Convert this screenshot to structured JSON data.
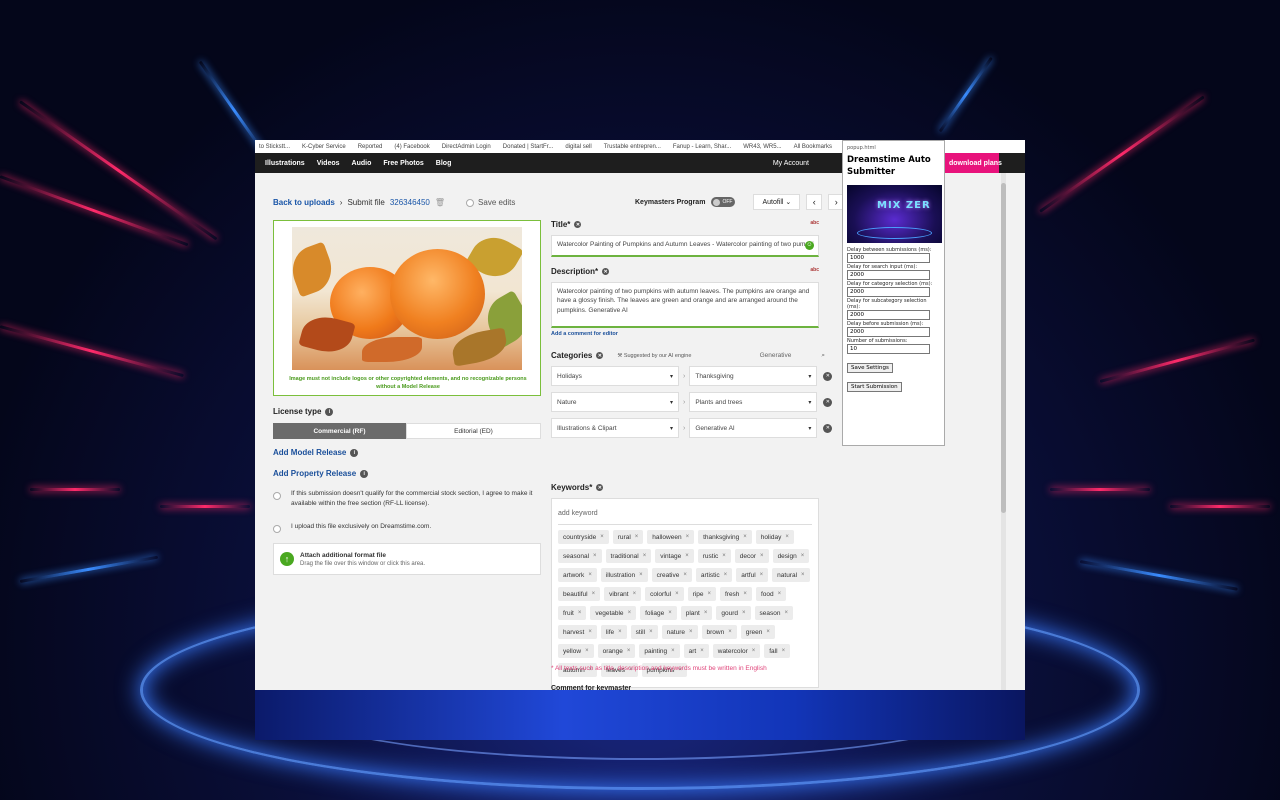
{
  "bookmarks": [
    "to Stickstt...",
    "K-Cyber Service",
    "Reported",
    "(4) Facebook",
    "DirectAdmin Login",
    "Donated | StartFr...",
    "digital sell",
    "Trustable entrepren...",
    "Fanup - Learn, Shar...",
    "WR43, WR5...",
    "All Bookmarks"
  ],
  "nav": {
    "items": [
      "Illustrations",
      "Videos",
      "Audio",
      "Free Photos",
      "Blog"
    ],
    "account": "My Account",
    "download_plans": "download plans"
  },
  "breadcrumb": {
    "back": "Back to uploads",
    "sep": "›",
    "submit": "Submit file",
    "file_number": "326346450",
    "save_edits": "Save edits"
  },
  "toolbar": {
    "keymasters": "Keymasters Program",
    "toggle": "OFF",
    "autofill": "Autofill",
    "prev": "‹",
    "next": "›"
  },
  "image_note": "Image must not include logos or other copyrighted elements, and no recognizable persons without a Model Release",
  "license": {
    "label": "License type",
    "commercial": "Commercial (RF)",
    "editorial": "Editorial (ED)"
  },
  "links": {
    "model_release": "Add Model Release",
    "property_release": "Add Property Release"
  },
  "options": {
    "free_section": "If this submission doesn't qualify for the commercial stock section, I agree to make it available within the free section (RF-LL license).",
    "exclusive": "I upload this file exclusively on Dreamstime.com."
  },
  "attach": {
    "title": "Attach additional format file",
    "subtitle": "Drag the file over this window or click this area."
  },
  "title_field": {
    "label": "Title*",
    "value": "Watercolor Painting of Pumpkins and Autumn Leaves - Watercolor painting of two pumpki",
    "badge": "abc"
  },
  "description_field": {
    "label": "Description*",
    "value": "Watercolor painting of two pumpkins with autumn leaves. The pumpkins are orange and have a glossy finish. The leaves are green and orange and are arranged around the pumpkins. Generative AI",
    "comment_link": "Add a comment for editor",
    "badge": "abc"
  },
  "categories": {
    "label": "Categories",
    "ai_hint": "Suggested by our AI engine",
    "search_value": "Generative",
    "rows": [
      {
        "main": "Holidays",
        "sub": "Thanksgiving"
      },
      {
        "main": "Nature",
        "sub": "Plants and trees"
      },
      {
        "main": "Illustrations & Clipart",
        "sub": "Generative AI"
      }
    ]
  },
  "keywords": {
    "label": "Keywords*",
    "placeholder": "add keyword",
    "tags": [
      "countryside",
      "rural",
      "halloween",
      "thanksgiving",
      "holiday",
      "seasonal",
      "traditional",
      "vintage",
      "rustic",
      "decor",
      "design",
      "artwork",
      "illustration",
      "creative",
      "artistic",
      "artful",
      "natural",
      "beautiful",
      "vibrant",
      "colorful",
      "ripe",
      "fresh",
      "food",
      "fruit",
      "vegetable",
      "foliage",
      "plant",
      "gourd",
      "season",
      "harvest",
      "life",
      "still",
      "nature",
      "brown",
      "green",
      "yellow",
      "orange",
      "painting",
      "art",
      "watercolor",
      "fall",
      "autumn",
      "leaves",
      "pumpkins"
    ]
  },
  "english_note": "* All texts such as title, description and keywords must be written in English",
  "comment_label": "Comment for keymaster",
  "popup": {
    "header": "popup.html",
    "title": "Dreamstime Auto Submitter",
    "logo_text": "MIX ZER",
    "fields": [
      {
        "label": "Delay between submissions (ms):",
        "value": "1000"
      },
      {
        "label": "Delay for search input (ms):",
        "value": "2000"
      },
      {
        "label": "Delay for category selection (ms):",
        "value": "2000"
      },
      {
        "label": "Delay for subcategory selection (ms):",
        "value": "2000"
      },
      {
        "label": "Delay before submission (ms):",
        "value": "2000"
      },
      {
        "label": "Number of submissions:",
        "value": "10"
      }
    ],
    "save_button": "Save Settings",
    "start_button": "Start Submission"
  },
  "colors": {
    "accent_pink": "#e8137c",
    "link_blue": "#1a56a8",
    "valid_green": "#6db33f"
  }
}
